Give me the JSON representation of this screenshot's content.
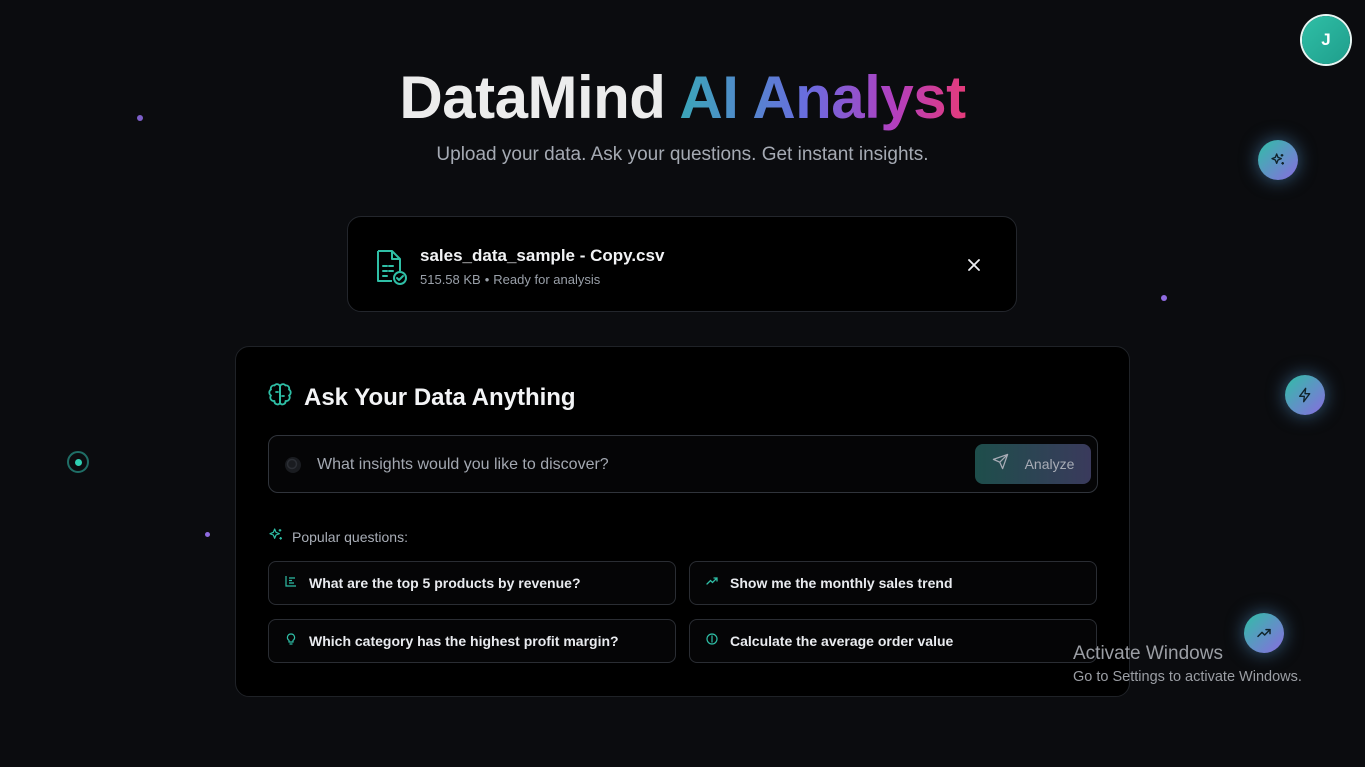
{
  "user": {
    "avatar_initial": "J"
  },
  "header": {
    "title_part1": "DataMind",
    "title_part2": "AI Analyst",
    "subtitle": "Upload your data. Ask your questions. Get instant insights."
  },
  "file": {
    "name": "sales_data_sample - Copy.csv",
    "size": "515.58 KB",
    "separator": "•",
    "status": "Ready for analysis"
  },
  "ask": {
    "title": "Ask Your Data Anything",
    "search_placeholder": "What insights would you like to discover?",
    "search_value": "",
    "analyze_label": "Analyze",
    "popular_label": "Popular questions:",
    "questions": [
      {
        "icon": "bar-chart-icon",
        "text": "What are the top 5 products by revenue?"
      },
      {
        "icon": "trending-up-icon",
        "text": "Show me the monthly sales trend"
      },
      {
        "icon": "lightbulb-icon",
        "text": "Which category has the highest profit margin?"
      },
      {
        "icon": "dollar-icon",
        "text": "Calculate the average order value"
      }
    ]
  },
  "floating_icons": [
    "sparkles-icon",
    "lightning-icon",
    "trending-up-icon"
  ],
  "watermark": {
    "line1": "Activate Windows",
    "line2": "Go to Settings to activate Windows."
  },
  "colors": {
    "background": "#0b0c0f",
    "accent_teal": "#2fbfa6",
    "accent_purple": "#8a6be0",
    "accent_pink": "#e53b7a"
  }
}
